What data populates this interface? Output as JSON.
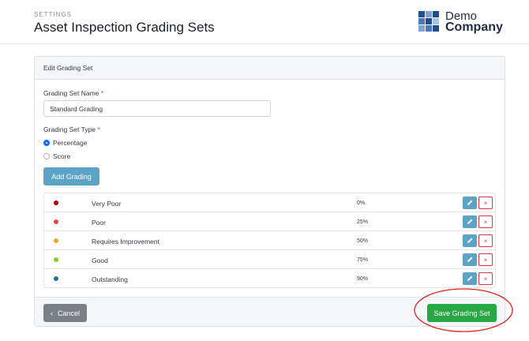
{
  "header": {
    "eyebrow": "SETTINGS",
    "title": "Asset Inspection Grading Sets",
    "logo": {
      "line1": "Demo",
      "line2": "Company",
      "color": "#1f2a44"
    }
  },
  "card": {
    "header_title": "Edit Grading Set",
    "name_label": "Grading Set Name",
    "name_required": "*",
    "name_value": "Standard Grading",
    "type_label": "Grading Set Type",
    "type_required": "*",
    "type_options": [
      {
        "label": "Percentage",
        "selected": true
      },
      {
        "label": "Score",
        "selected": false
      }
    ],
    "add_button": "Add Grading",
    "gradings": [
      {
        "name": "Very Poor",
        "value": "0%",
        "color": "#b30000"
      },
      {
        "name": "Poor",
        "value": "25%",
        "color": "#e8453c"
      },
      {
        "name": "Requires Improvement",
        "value": "50%",
        "color": "#f5a623"
      },
      {
        "name": "Good",
        "value": "75%",
        "color": "#7ed321"
      },
      {
        "name": "Outstanding",
        "value": "90%",
        "color": "#1f6fa3"
      }
    ],
    "delete_glyph": "×",
    "cancel_icon": "chevron-left-icon",
    "cancel_glyph": "‹",
    "cancel_button": "Cancel",
    "save_button": "Save Grading Set"
  },
  "colors": {
    "primary": "#5ba4c6",
    "success": "#28a745",
    "danger": "#dc3545",
    "secondary": "#7a8087",
    "annotation": "#e0241b"
  }
}
